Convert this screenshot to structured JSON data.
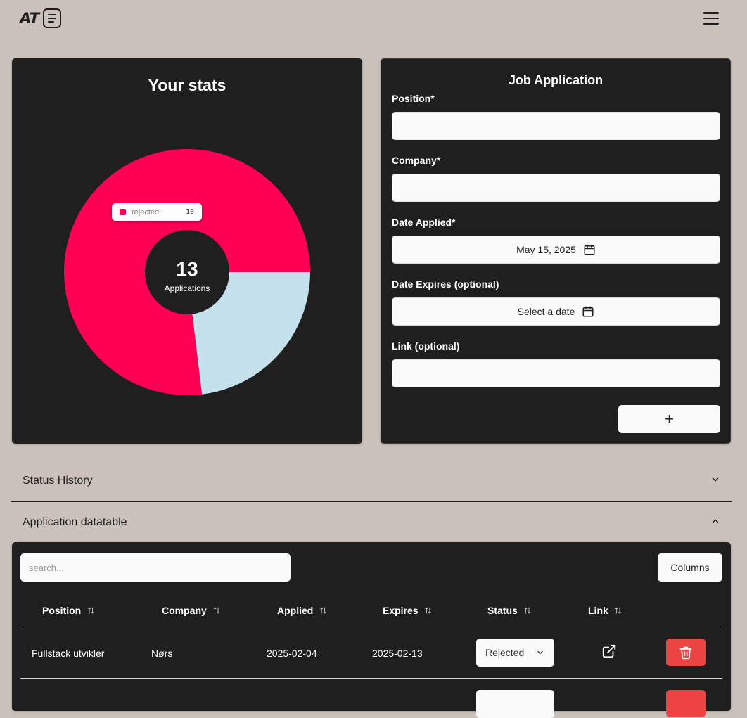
{
  "header": {
    "logo_text": "AT",
    "logo_icon": "document-icon",
    "menu_icon": "hamburger-menu-icon"
  },
  "stats": {
    "title": "Your stats",
    "total": "13",
    "total_label": "Applications",
    "tooltip": {
      "label": "rejected:",
      "value": "10",
      "color": "#ff0055"
    }
  },
  "chart_data": {
    "type": "pie",
    "title": "Your stats",
    "series": [
      {
        "name": "rejected",
        "value": 10,
        "color": "#ff0055"
      },
      {
        "value": 3,
        "color": "#c5e2ec"
      }
    ],
    "center_text": "13",
    "center_subtext": "Applications"
  },
  "form": {
    "title": "Job Application",
    "position_label": "Position*",
    "position_value": "",
    "company_label": "Company*",
    "company_value": "",
    "date_applied_label": "Date Applied*",
    "date_applied_value": "May 15, 2025",
    "date_expires_label": "Date Expires (optional)",
    "date_expires_value": "Select a date",
    "link_label": "Link (optional)",
    "link_value": "",
    "add_button": "+"
  },
  "accordions": {
    "status_history": "Status History",
    "datatable": "Application datatable"
  },
  "table": {
    "search_placeholder": "search...",
    "columns_button": "Columns",
    "headers": [
      "Position",
      "Company",
      "Applied",
      "Expires",
      "Status",
      "Link"
    ],
    "rows": [
      {
        "position": "Fullstack utvikler",
        "company": "Nørs",
        "applied": "2025-02-04",
        "expires": "2025-02-13",
        "status": "Rejected"
      }
    ]
  },
  "colors": {
    "background": "#cac2bb",
    "card": "#201f20",
    "rejected": "#ff0055",
    "other": "#c5e2ec",
    "delete": "#ef4444"
  }
}
